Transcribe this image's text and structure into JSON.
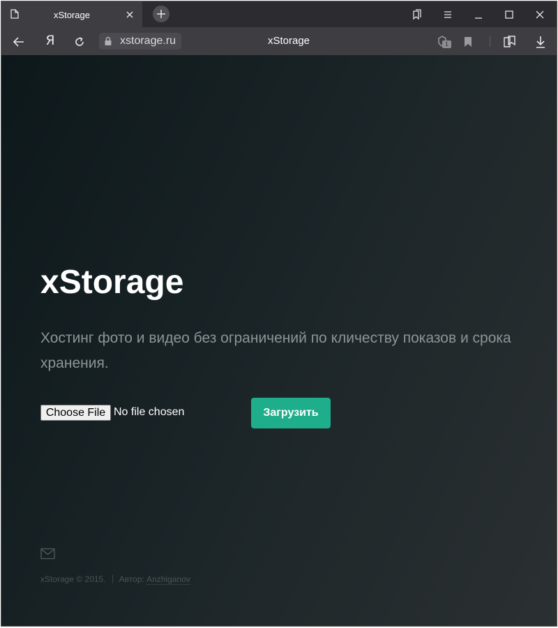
{
  "browser": {
    "tab": {
      "title": "xStorage"
    },
    "address": {
      "domain": "xstorage.ru"
    },
    "page_title": "xStorage",
    "yandex_label": "Я",
    "shield_badge": "1"
  },
  "page": {
    "title": "xStorage",
    "subtitle": "Хостинг фото и видео без ограничений по кличеству показов и срока хранения.",
    "file_input": {
      "button_label": "Choose File",
      "status": "No file chosen"
    },
    "upload_button": "Загрузить",
    "footer": {
      "copyright": "xStorage © 2015.",
      "author_label": "Автор:",
      "author_name": "Anzhiganov"
    }
  },
  "colors": {
    "accent": "#1fae8c",
    "background_dark": "#0d181b",
    "browser_chrome": "#3d3d42"
  }
}
